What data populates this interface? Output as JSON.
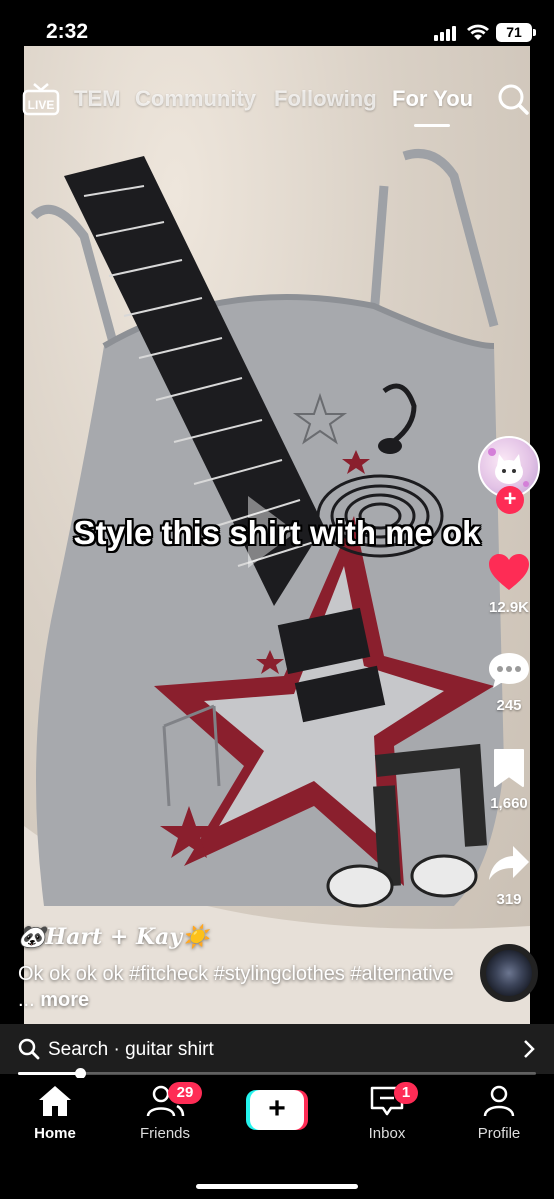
{
  "status_bar": {
    "time": "2:32",
    "battery": "71"
  },
  "top_nav": {
    "tabs": [
      {
        "label": "TEM",
        "active": false
      },
      {
        "label": "Community",
        "active": false
      },
      {
        "label": "Following",
        "active": false
      },
      {
        "label": "For You",
        "active": true
      }
    ],
    "live_label": "LIVE"
  },
  "video": {
    "overlay_caption": "Style this shirt with me ok",
    "author": "🐼𝑯𝒂𝒓𝒕 + 𝑲𝒂𝒚☀️",
    "description": "Ok ok ok ok #fitcheck #stylingclothes #alternative ...",
    "more_label": "more"
  },
  "actions": {
    "likes": "12.9K",
    "comments": "245",
    "bookmarks": "1,660",
    "shares": "319"
  },
  "search_bar": {
    "text": "Search · guitar shirt"
  },
  "progress": {
    "fraction": 0.12
  },
  "tab_bar": {
    "home": "Home",
    "friends": "Friends",
    "friends_badge": "29",
    "inbox": "Inbox",
    "inbox_badge": "1",
    "profile": "Profile",
    "create": "+"
  },
  "colors": {
    "accent": "#fe2c55",
    "cyan": "#25f4ee",
    "like": "#fe2c55"
  }
}
